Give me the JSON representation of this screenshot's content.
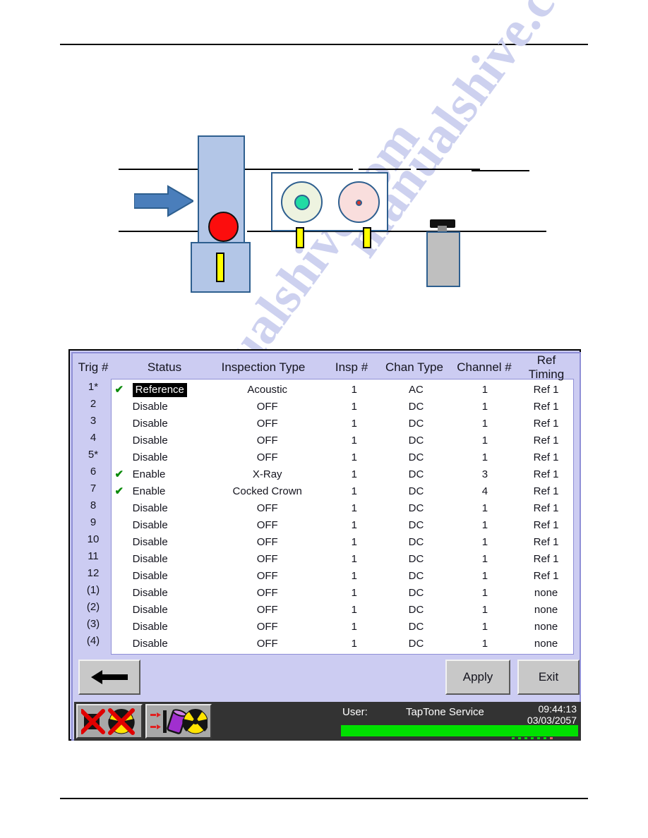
{
  "diagram": {
    "name": "conveyor-inspection-diagram",
    "flow_arrow": "flow-direction-arrow",
    "pusher": "reject-pusher",
    "sensor_housing": "dual-sensor-housing",
    "reject_device": "reject-device"
  },
  "watermark": {
    "line1": "manualshive.com",
    "line2": "manualshive.com"
  },
  "panel": {
    "columns": [
      "Trig #",
      "Status",
      "Inspection Type",
      "Insp #",
      "Chan Type",
      "Channel #",
      "Ref Timing"
    ],
    "rows": [
      {
        "trig": "1*",
        "check": "✔",
        "status": "Reference",
        "selected": true,
        "type": "Acoustic",
        "insp": "1",
        "chan_type": "AC",
        "channel": "1",
        "ref": "Ref 1"
      },
      {
        "trig": "2",
        "check": "",
        "status": "Disable",
        "selected": false,
        "type": "OFF",
        "insp": "1",
        "chan_type": "DC",
        "channel": "1",
        "ref": "Ref 1"
      },
      {
        "trig": "3",
        "check": "",
        "status": "Disable",
        "selected": false,
        "type": "OFF",
        "insp": "1",
        "chan_type": "DC",
        "channel": "1",
        "ref": "Ref 1"
      },
      {
        "trig": "4",
        "check": "",
        "status": "Disable",
        "selected": false,
        "type": "OFF",
        "insp": "1",
        "chan_type": "DC",
        "channel": "1",
        "ref": "Ref 1"
      },
      {
        "trig": "5*",
        "check": "",
        "status": "Disable",
        "selected": false,
        "type": "OFF",
        "insp": "1",
        "chan_type": "DC",
        "channel": "1",
        "ref": "Ref 1"
      },
      {
        "trig": "6",
        "check": "✔",
        "status": "Enable",
        "selected": false,
        "type": "X-Ray",
        "insp": "1",
        "chan_type": "DC",
        "channel": "3",
        "ref": "Ref 1"
      },
      {
        "trig": "7",
        "check": "✔",
        "status": "Enable",
        "selected": false,
        "type": "Cocked Crown",
        "insp": "1",
        "chan_type": "DC",
        "channel": "4",
        "ref": "Ref 1"
      },
      {
        "trig": "8",
        "check": "",
        "status": "Disable",
        "selected": false,
        "type": "OFF",
        "insp": "1",
        "chan_type": "DC",
        "channel": "1",
        "ref": "Ref 1"
      },
      {
        "trig": "9",
        "check": "",
        "status": "Disable",
        "selected": false,
        "type": "OFF",
        "insp": "1",
        "chan_type": "DC",
        "channel": "1",
        "ref": "Ref 1"
      },
      {
        "trig": "10",
        "check": "",
        "status": "Disable",
        "selected": false,
        "type": "OFF",
        "insp": "1",
        "chan_type": "DC",
        "channel": "1",
        "ref": "Ref 1"
      },
      {
        "trig": "11",
        "check": "",
        "status": "Disable",
        "selected": false,
        "type": "OFF",
        "insp": "1",
        "chan_type": "DC",
        "channel": "1",
        "ref": "Ref 1"
      },
      {
        "trig": "12",
        "check": "",
        "status": "Disable",
        "selected": false,
        "type": "OFF",
        "insp": "1",
        "chan_type": "DC",
        "channel": "1",
        "ref": "Ref 1"
      },
      {
        "trig": "(1)",
        "check": "",
        "status": "Disable",
        "selected": false,
        "type": "OFF",
        "insp": "1",
        "chan_type": "DC",
        "channel": "1",
        "ref": "none"
      },
      {
        "trig": "(2)",
        "check": "",
        "status": "Disable",
        "selected": false,
        "type": "OFF",
        "insp": "1",
        "chan_type": "DC",
        "channel": "1",
        "ref": "none"
      },
      {
        "trig": "(3)",
        "check": "",
        "status": "Disable",
        "selected": false,
        "type": "OFF",
        "insp": "1",
        "chan_type": "DC",
        "channel": "1",
        "ref": "none"
      },
      {
        "trig": "(4)",
        "check": "",
        "status": "Disable",
        "selected": false,
        "type": "OFF",
        "insp": "1",
        "chan_type": "DC",
        "channel": "1",
        "ref": "none"
      }
    ],
    "buttons": {
      "back": "",
      "apply": "Apply",
      "exit": "Exit"
    }
  },
  "statusbar": {
    "tool_xray_off": "xray-disabled-icon",
    "tool_xray_on": "xray-enabled-icon",
    "user_label": "User:",
    "user_name": "TapTone Service",
    "time": "09:44:13",
    "date": "03/03/2057",
    "progress_percent": 100,
    "progress_color": "#00e000"
  }
}
